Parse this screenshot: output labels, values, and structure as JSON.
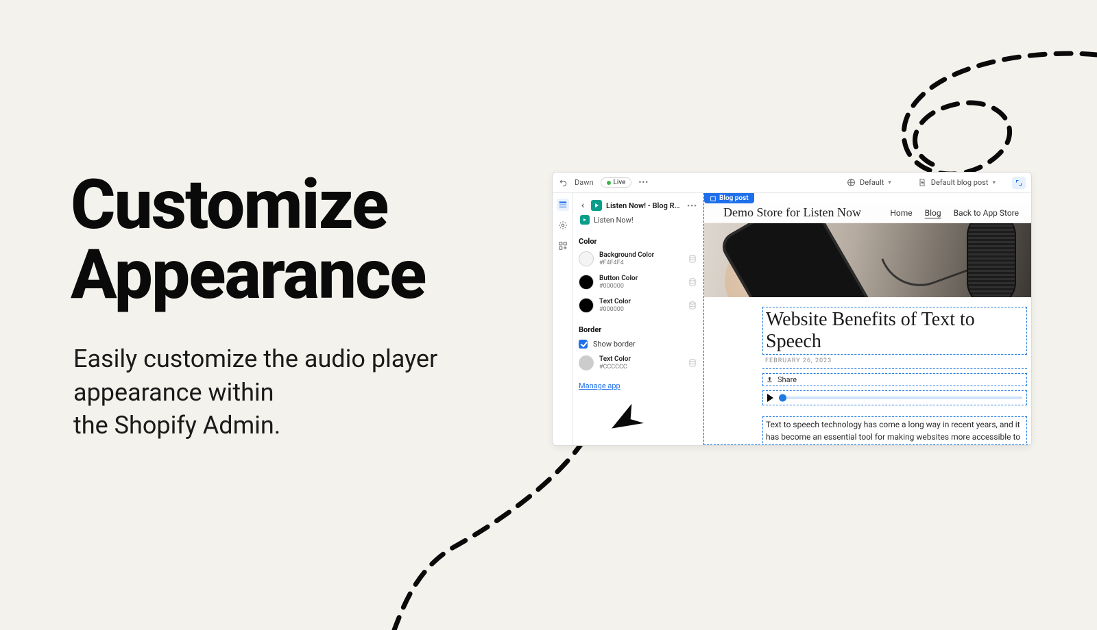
{
  "hero": {
    "title_line1": "Customize",
    "title_line2": "Appearance",
    "sub_line1": "Easily customize the audio player",
    "sub_line2": "appearance within",
    "sub_line3": "the Shopify Admin."
  },
  "topbar": {
    "theme_name": "Dawn",
    "live_label": "Live",
    "template_label": "Default",
    "page_label": "Default blog post"
  },
  "rail": {
    "items": [
      "sections",
      "settings",
      "apps"
    ]
  },
  "sidebar": {
    "crumb": "Listen Now! - Blog Reader",
    "app_name": "Listen Now!",
    "section_color": "Color",
    "colors": [
      {
        "name": "Background Color",
        "hex": "#F4F4F4",
        "swatch": "#F4F4F4"
      },
      {
        "name": "Button Color",
        "hex": "#000000",
        "swatch": "#000000"
      },
      {
        "name": "Text Color",
        "hex": "#000000",
        "swatch": "#000000"
      }
    ],
    "section_border": "Border",
    "show_border_label": "Show border",
    "show_border_checked": true,
    "border_color": {
      "name": "Text Color",
      "hex": "#CCCCCC",
      "swatch": "#CCCCCC"
    },
    "manage_app": "Manage app"
  },
  "preview": {
    "blog_post_tag": "Blog post",
    "brand": "Demo Store for Listen Now",
    "nav": {
      "home": "Home",
      "blog": "Blog",
      "back": "Back to App Store"
    },
    "article_title": "Website Benefits of Text to Speech",
    "article_date": "FEBRUARY 26, 2023",
    "share_label": "Share",
    "body": "Text to speech technology has come a long way in recent years, and it has become an essential tool for making websites more accessible to all users. In this blog post, we will discuss the be"
  }
}
